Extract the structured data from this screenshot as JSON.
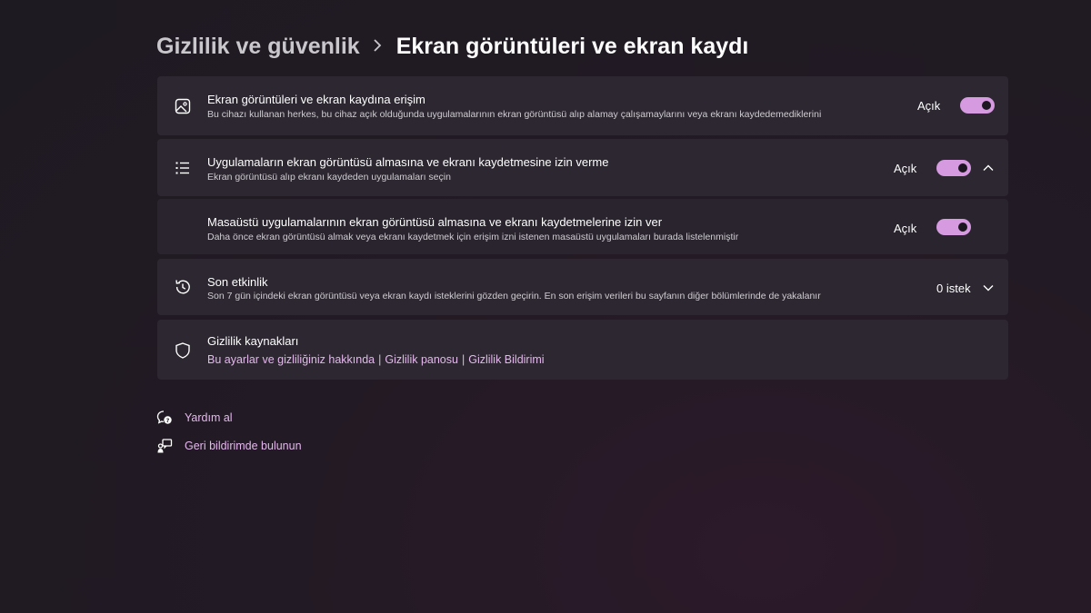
{
  "breadcrumb": {
    "parent": "Gizlilik ve güvenlik",
    "separator": "›",
    "current": "Ekran görüntüleri ve ekran kaydı"
  },
  "cards": {
    "access": {
      "icon": "image-icon",
      "title": "Ekran görüntüleri ve ekran kaydına erişim",
      "description": "Bu cihazı kullanan herkes, bu cihaz açık olduğunda uygulamalarının ekran görüntüsü alıp alamay çalışamaylarını veya ekranı kaydedemediklerini",
      "state": "Açık",
      "toggle_on": true
    },
    "apps": {
      "icon": "list-icon",
      "title": "Uygulamaların ekran görüntüsü almasına ve ekranı kaydetmesine izin verme",
      "description": "Ekran görüntüsü alıp ekranı kaydeden uygulamaları seçin",
      "state": "Açık",
      "toggle_on": true,
      "expanded": true
    },
    "desktop": {
      "title": "Masaüstü uygulamalarının ekran görüntüsü almasına ve ekranı kaydetmelerine izin ver",
      "description": "Daha önce ekran görüntüsü almak veya ekranı kaydetmek için erişim izni istenen masaüstü uygulamaları burada listelenmiştir",
      "state": "Açık",
      "toggle_on": true
    },
    "activity": {
      "icon": "history-icon",
      "title": "Son etkinlik",
      "description": "Son 7 gün içindeki ekran görüntüsü veya ekran kaydı isteklerini gözden geçirin. En son erişim verileri bu sayfanın diğer bölümlerinde de yakalanır",
      "count": "0 istek"
    },
    "resources": {
      "icon": "shield-icon",
      "title": "Gizlilik kaynakları",
      "links": [
        "Bu ayarlar ve gizliliğiniz hakkında",
        "Gizlilik panosu",
        "Gizlilik Bildirimi"
      ],
      "separator": "|"
    }
  },
  "help": {
    "get_help": "Yardım al",
    "feedback": "Geri bildirimde bulunun"
  },
  "colors": {
    "accent": "#d59ae0",
    "link": "#e5b8ee",
    "card": "#2c2730"
  }
}
